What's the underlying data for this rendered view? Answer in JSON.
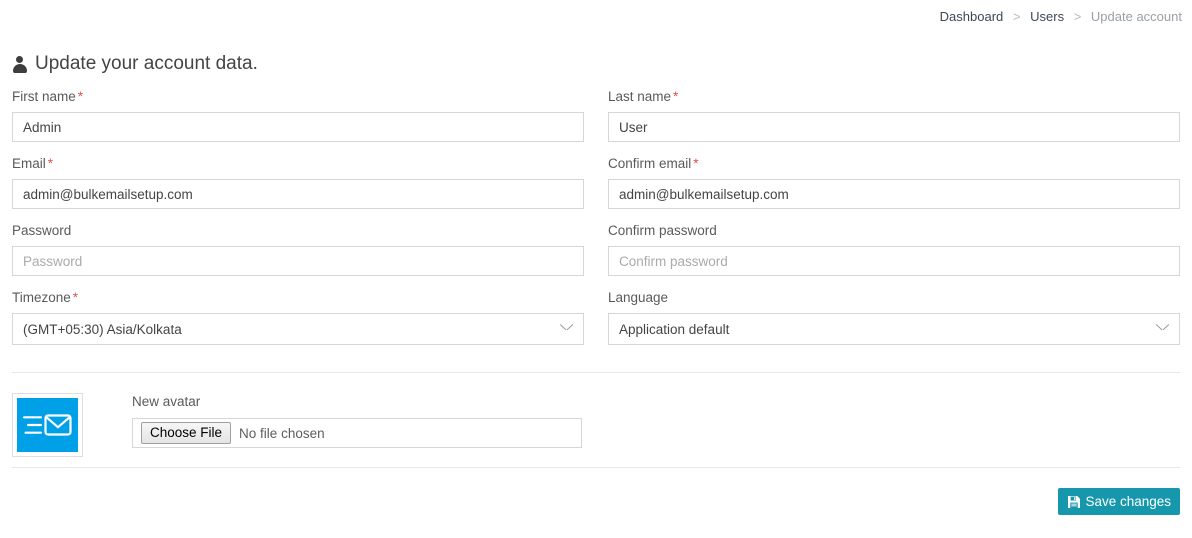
{
  "breadcrumb": {
    "items": [
      {
        "label": "Dashboard",
        "current": false
      },
      {
        "label": "Users",
        "current": false
      },
      {
        "label": "Update account",
        "current": true
      }
    ],
    "separator": ">"
  },
  "page": {
    "title": "Update your account data.",
    "title_icon": "user-icon"
  },
  "form": {
    "rows": [
      {
        "left": {
          "label": "First name",
          "required_marker": "*",
          "value": "Admin",
          "placeholder": "",
          "type": "text"
        },
        "right": {
          "label": "Last name",
          "required_marker": "*",
          "value": "User",
          "placeholder": "",
          "type": "text"
        }
      },
      {
        "left": {
          "label": "Email",
          "required_marker": "*",
          "value": "admin@bulkemailsetup.com",
          "placeholder": "",
          "type": "text"
        },
        "right": {
          "label": "Confirm email",
          "required_marker": "*",
          "value": "admin@bulkemailsetup.com",
          "placeholder": "",
          "type": "text"
        }
      },
      {
        "left": {
          "label": "Password",
          "required_marker": "",
          "value": "",
          "placeholder": "Password",
          "type": "password"
        },
        "right": {
          "label": "Confirm password",
          "required_marker": "",
          "value": "",
          "placeholder": "Confirm password",
          "type": "password"
        }
      },
      {
        "left": {
          "label": "Timezone",
          "required_marker": "*",
          "value": "(GMT+05:30) Asia/Kolkata",
          "placeholder": "",
          "type": "select",
          "chevron_icon": "chevron-down-icon"
        },
        "right": {
          "label": "Language",
          "required_marker": "",
          "value": "Application default",
          "placeholder": "",
          "type": "select",
          "chevron_icon": "chevron-down-icon"
        }
      }
    ]
  },
  "avatar": {
    "current_avatar_icon": "envelope-avatar-icon",
    "avatar_bg_color": "#00a0e9",
    "new_avatar_label": "New avatar",
    "choose_file_label": "Choose File",
    "file_status": "No file chosen"
  },
  "footer": {
    "save_label": "Save changes",
    "save_icon": "floppy-disk-save-icon",
    "save_color": "#1797ab"
  }
}
